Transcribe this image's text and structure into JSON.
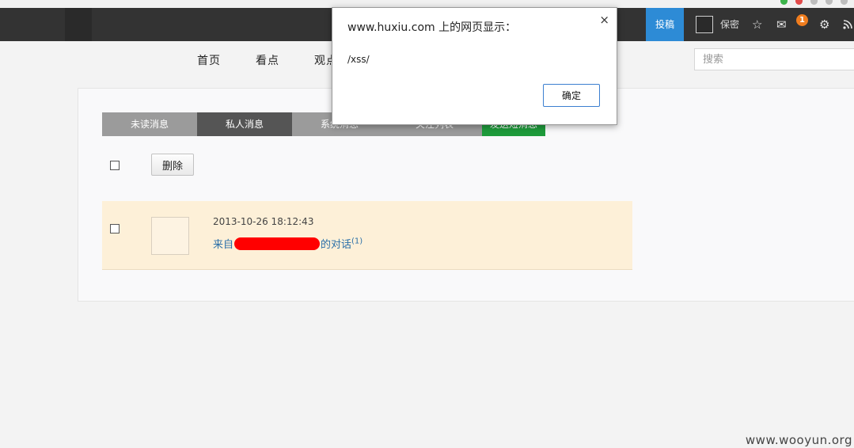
{
  "header": {
    "submit_label": "投稿",
    "username": "保密",
    "notification_count": "1",
    "icons": [
      "star-icon",
      "mail-icon",
      "gear-icon",
      "rss-icon"
    ]
  },
  "nav": {
    "items": [
      "首页",
      "看点",
      "观点"
    ],
    "search_placeholder": "搜索"
  },
  "tabs": [
    {
      "label": "未读消息",
      "active": false
    },
    {
      "label": "私人消息",
      "active": true
    },
    {
      "label": "系统消息",
      "active": false
    },
    {
      "label": "关注列表",
      "active": false
    },
    {
      "label": "发送短消息",
      "active": false
    }
  ],
  "toolbar": {
    "delete_label": "删除"
  },
  "messages": [
    {
      "time": "2013-10-26 18:12:43",
      "prefix": "来自",
      "suffix": "的对话",
      "count": "(1)"
    }
  ],
  "dialog": {
    "title": "www.huxiu.com 上的网页显示：",
    "message": "/xss/",
    "ok_label": "确定",
    "close_glyph": "×"
  },
  "watermark": "www.wooyun.org",
  "colors": {
    "topbar": "#333333",
    "submit": "#2d8bd6",
    "tab_active": "#555555",
    "tab_green": "#1e9b3b",
    "message_bg": "#fdf0d8",
    "badge": "#f07d1e",
    "redaction": "#ff0000"
  }
}
